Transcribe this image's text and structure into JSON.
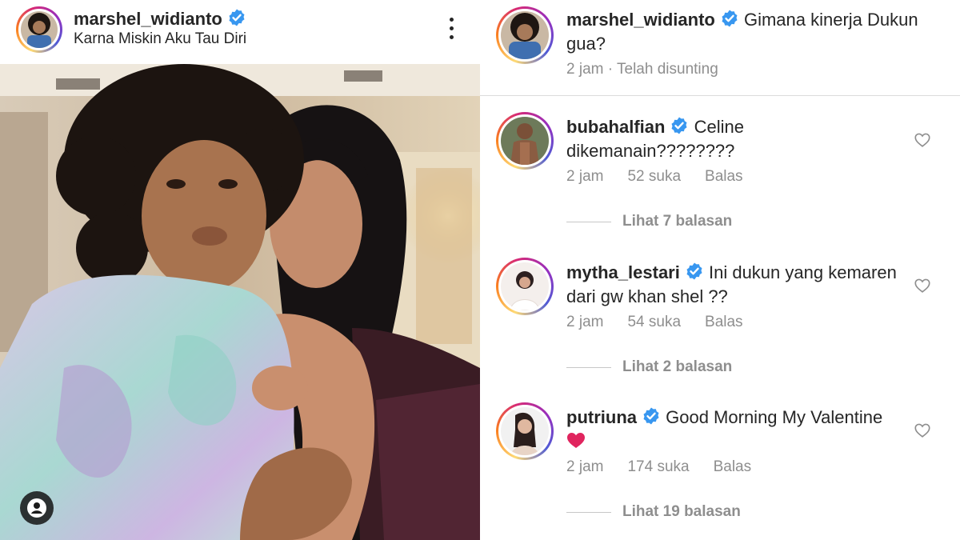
{
  "post": {
    "username": "marshel_widianto",
    "subtitle": "Karna Miskin Aku Tau Diri",
    "more_icon": "more-vertical-icon",
    "tag_icon": "tagged-user-icon"
  },
  "caption": {
    "username": "marshel_widianto",
    "text": "Gimana kinerja Dukun gua?",
    "time": "2 jam",
    "separator": "·",
    "edited": "Telah disunting"
  },
  "comments": [
    {
      "username": "bubahalfian",
      "text": "Celine dikemanain????????",
      "time": "2 jam",
      "likes": "52 suka",
      "reply": "Balas",
      "view_replies": "Lihat 7 balasan"
    },
    {
      "username": "mytha_lestari",
      "text": "Ini dukun yang kemaren dari gw khan shel ??",
      "time": "2 jam",
      "likes": "54 suka",
      "reply": "Balas",
      "view_replies": "Lihat 2 balasan"
    },
    {
      "username": "putriuna",
      "text": "Good Morning My Valentine",
      "emoji": "❤",
      "time": "2 jam",
      "likes": "174 suka",
      "reply": "Balas",
      "view_replies": "Lihat 19 balasan"
    }
  ],
  "colors": {
    "verified": "#3897f0",
    "meta_text": "#8e8e8e",
    "heart_red": "#e0245e"
  }
}
